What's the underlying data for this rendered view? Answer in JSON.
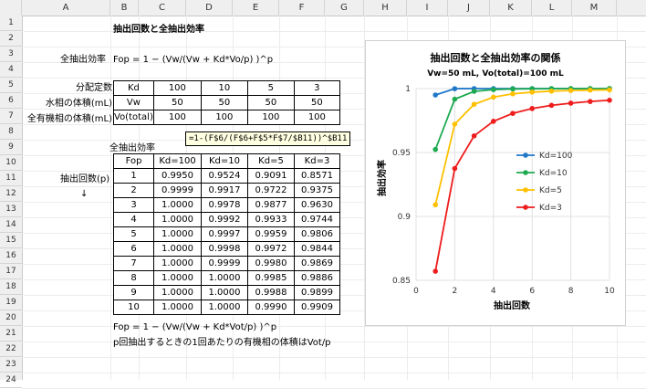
{
  "columns": [
    "A",
    "B",
    "C",
    "D",
    "E",
    "F",
    "G",
    "H",
    "I",
    "J",
    "K",
    "L",
    "M"
  ],
  "rows": [
    "1",
    "2",
    "3",
    "4",
    "5",
    "6",
    "7",
    "8",
    "9",
    "10",
    "11",
    "12",
    "13",
    "14",
    "15",
    "16",
    "17",
    "18",
    "19",
    "20",
    "21",
    "22",
    "23",
    "24"
  ],
  "sheet": {
    "title": "抽出回数と全抽出効率",
    "formula_label": "全抽出効率",
    "formula": "Fop = 1 − (Vw/(Vw + Kd*Vo/p) )^p",
    "param_label_kd": "分配定数",
    "param_label_vw": "水相の体積(mL)",
    "param_label_vo": "全有機相の体積(mL)",
    "params": [
      [
        "Kd",
        "100",
        "10",
        "5",
        "3"
      ],
      [
        "Vw",
        "50",
        "50",
        "50",
        "50"
      ],
      [
        "Vo(total)",
        "100",
        "100",
        "100",
        "100"
      ]
    ],
    "table_title": "全抽出効率",
    "extract_label": "抽出回数(p)",
    "arrow": "↓",
    "cell_tooltip": "=1-(F$6/(F$6+F$5*F$7/$B11))^$B11",
    "table_header": [
      "Fop",
      "Kd=100",
      "Kd=10",
      "Kd=5",
      "Kd=3"
    ],
    "table_rows": [
      [
        "1",
        "0.9950",
        "0.9524",
        "0.9091",
        "0.8571"
      ],
      [
        "2",
        "0.9999",
        "0.9917",
        "0.9722",
        "0.9375"
      ],
      [
        "3",
        "1.0000",
        "0.9978",
        "0.9877",
        "0.9630"
      ],
      [
        "4",
        "1.0000",
        "0.9992",
        "0.9933",
        "0.9744"
      ],
      [
        "5",
        "1.0000",
        "0.9997",
        "0.9959",
        "0.9806"
      ],
      [
        "6",
        "1.0000",
        "0.9998",
        "0.9972",
        "0.9844"
      ],
      [
        "7",
        "1.0000",
        "0.9999",
        "0.9980",
        "0.9869"
      ],
      [
        "8",
        "1.0000",
        "1.0000",
        "0.9985",
        "0.9886"
      ],
      [
        "9",
        "1.0000",
        "1.0000",
        "0.9988",
        "0.9899"
      ],
      [
        "10",
        "1.0000",
        "1.0000",
        "0.9990",
        "0.9909"
      ]
    ],
    "footnote1": "Fop = 1 − (Vw/(Vw + Kd*Vot/p) )^p",
    "footnote2": "p回抽出するときの1回あたりの有機相の体積はVot/p"
  },
  "chart_data": {
    "type": "line",
    "title": "抽出回数と全抽出効率の関係",
    "subtitle": "Vw=50 mL, Vo(total)=100 mL",
    "xlabel": "抽出回数",
    "ylabel": "抽出効率",
    "xlim": [
      0,
      10
    ],
    "ylim": [
      0.85,
      1
    ],
    "xticks": [
      "0",
      "2",
      "4",
      "6",
      "8",
      "10"
    ],
    "yticks": [
      "0.85",
      "0.9",
      "0.95",
      "1"
    ],
    "grid": true,
    "legend_position": "center-right",
    "x": [
      1,
      2,
      3,
      4,
      5,
      6,
      7,
      8,
      9,
      10
    ],
    "series": [
      {
        "name": "Kd=100",
        "color": "#1f77c8",
        "values": [
          0.995,
          0.9999,
          1.0,
          1.0,
          1.0,
          1.0,
          1.0,
          1.0,
          1.0,
          1.0
        ]
      },
      {
        "name": "Kd=10",
        "color": "#1eaa50",
        "values": [
          0.9524,
          0.9917,
          0.9978,
          0.9992,
          0.9997,
          0.9998,
          0.9999,
          1.0,
          1.0,
          1.0
        ]
      },
      {
        "name": "Kd=5",
        "color": "#ffc000",
        "values": [
          0.9091,
          0.9722,
          0.9877,
          0.9933,
          0.9959,
          0.9972,
          0.998,
          0.9985,
          0.9988,
          0.999
        ]
      },
      {
        "name": "Kd=3",
        "color": "#ee1c1c",
        "values": [
          0.8571,
          0.9375,
          0.963,
          0.9744,
          0.9806,
          0.9844,
          0.9869,
          0.9886,
          0.9899,
          0.9909
        ]
      }
    ]
  }
}
